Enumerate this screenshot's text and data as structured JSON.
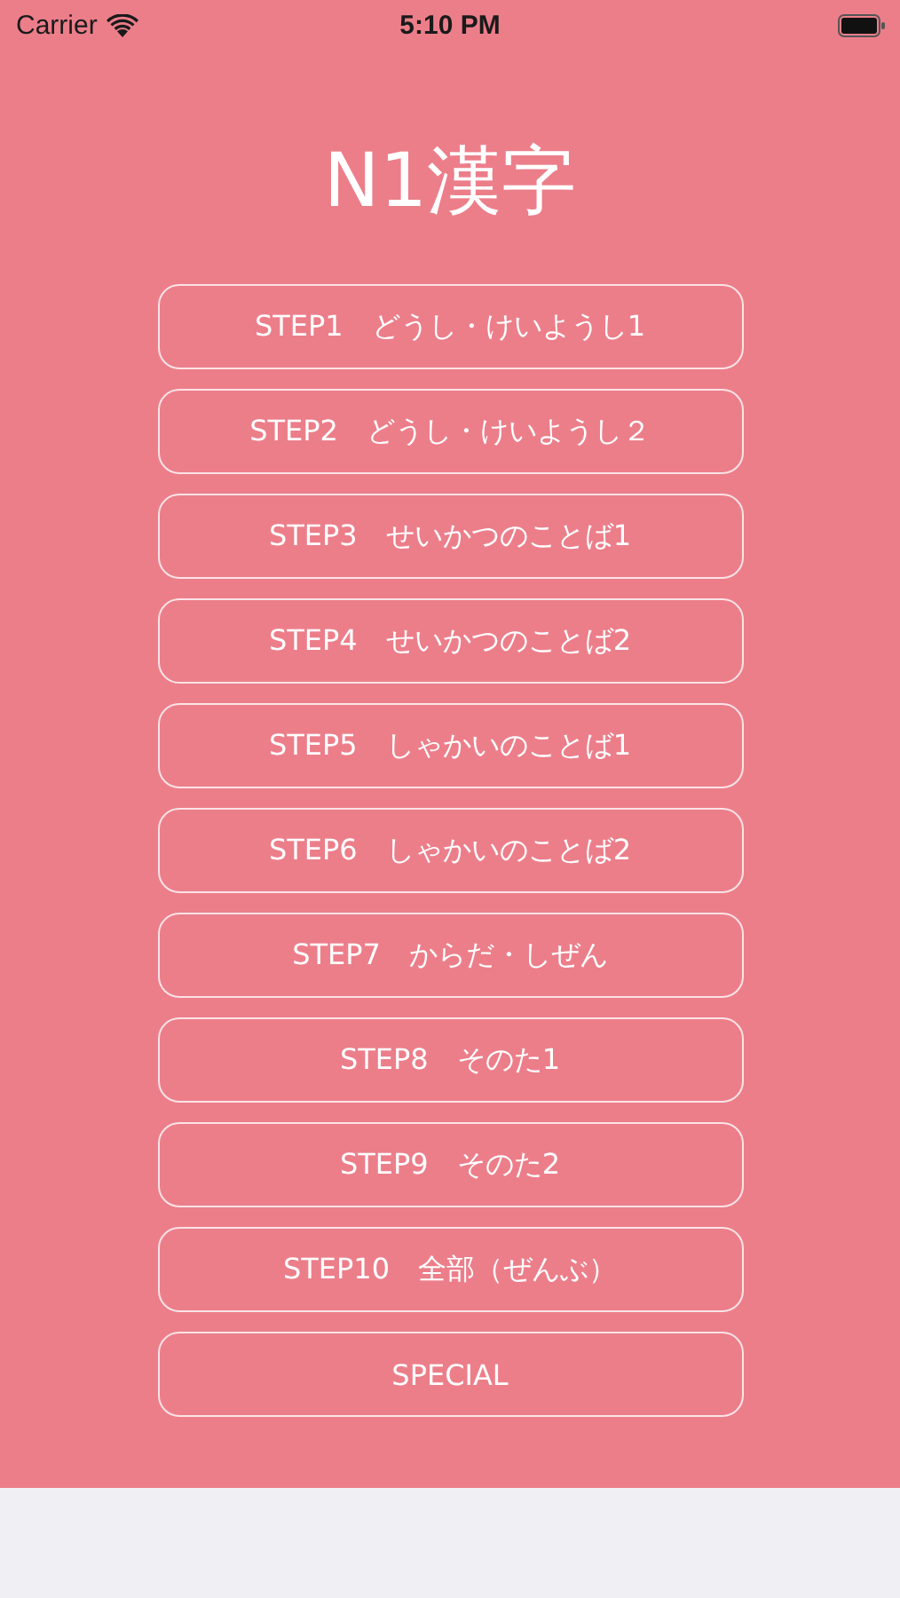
{
  "status_bar": {
    "carrier": "Carrier",
    "time": "5:10 PM"
  },
  "title": "N1漢字",
  "buttons": [
    {
      "label": "STEP1　どうし・けいようし1"
    },
    {
      "label": "STEP2　どうし・けいようし２"
    },
    {
      "label": "STEP3　せいかつのことば1"
    },
    {
      "label": "STEP4　せいかつのことば2"
    },
    {
      "label": "STEP5　しゃかいのことば1"
    },
    {
      "label": "STEP6　しゃかいのことば2"
    },
    {
      "label": "STEP7　からだ・しぜん"
    },
    {
      "label": "STEP8　そのた1"
    },
    {
      "label": "STEP9　そのた2"
    },
    {
      "label": "STEP10　全部（ぜんぶ）"
    },
    {
      "label": "SPECIAL"
    }
  ]
}
